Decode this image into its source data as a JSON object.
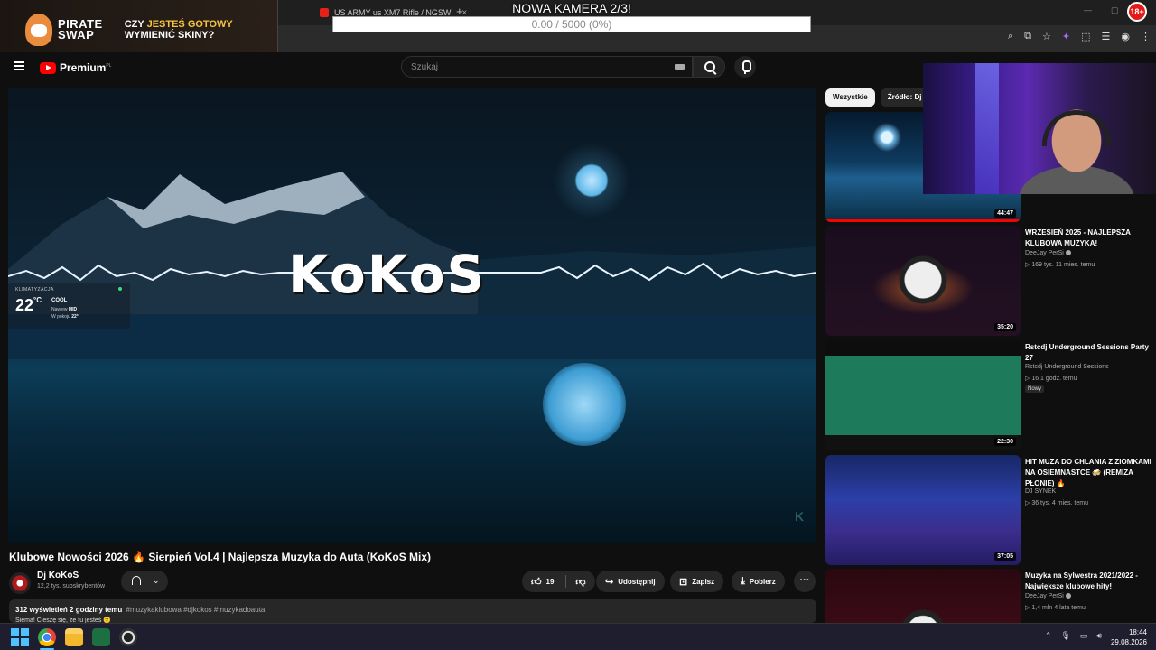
{
  "browser": {
    "tabs": [
      {
        "label": "US ARMY us XM7 Rifle / NGSW"
      }
    ],
    "new_tab": "+"
  },
  "overlay": {
    "camera_title": "NOWA KAMERA 2/3!",
    "camera_progress": "0.00 / 5000 (0%)",
    "camera_progress_fraction": 0,
    "age_badge": "18+"
  },
  "promo": {
    "brand_line1": "PIRATE",
    "brand_line2": "SWAP",
    "tagline_pre": "CZY ",
    "tagline_hl": "JESTEŚ GOTOWY",
    "tagline_line2": "WYMIENIĆ SKINY?"
  },
  "youtube": {
    "brand": "Premium",
    "brand_sup": "PL",
    "search_placeholder": "Szukaj"
  },
  "player": {
    "logo_text": "KoKoS",
    "ac": {
      "label": "KLIMATYZACJA",
      "temp": "22",
      "deg": "°C",
      "mode": "COOL",
      "fan_label": "Nawiew ",
      "fan_value": "MID",
      "room_label": "W pokoju ",
      "room_value": "22°"
    },
    "k_badge": "K"
  },
  "video": {
    "title": "Klubowe Nowości 2026 🔥 Sierpień Vol.4 | Najlepsza Muzyka do Auta (KoKoS Mix)",
    "channel": "Dj KoKoS",
    "subscribers": "12,2 tys. subskrybentów",
    "likes": "19",
    "share": "Udostępnij",
    "save": "Zapisz",
    "download": "Pobierz",
    "more": "···",
    "meta": "312 wyświetleń  2 godziny temu",
    "tags": "#muzykaklubowa #djkokos #muzykadoauta",
    "desc_line2": "Siema! Cieszę się, że tu jesteś 🙂"
  },
  "chips": [
    "Wszystkie",
    "Źródło: Dj K"
  ],
  "recommendations": [
    {
      "title": "",
      "channel": "",
      "stats": "",
      "duration": "44:47",
      "badge": ""
    },
    {
      "title": "WRZESIEŃ 2025 - NAJLEPSZA KLUBOWA MUZYKA!",
      "channel": "DeeJay PerSi",
      "stats": "▷ 169 tys.  11 mies. temu",
      "duration": "35:20",
      "badge": ""
    },
    {
      "title": "Rstcdj Underground Sessions Party 27",
      "channel": "Rstcdj Underground Sessions",
      "stats": "▷ 16  1 godz. temu",
      "duration": "22:30",
      "badge": "Nowy"
    },
    {
      "title": "HIT MUZA DO CHLANIA Z ZIOMKAMI NA OSIEMNASTCE 🍻 (REMIZA PŁONIE) 🔥",
      "channel": "DJ SYNEK",
      "stats": "▷ 36 tys.  4 mies. temu",
      "duration": "37:05",
      "badge": ""
    },
    {
      "title": "Muzyka na Sylwestra 2021/2022 - Największe klubowe hity!",
      "channel": "DeeJay PerSi",
      "stats": "▷ 1,4 mln  4 lata temu",
      "duration": "",
      "badge": ""
    }
  ],
  "taskbar": {
    "time": "18:44",
    "date": "29.08.2026"
  }
}
